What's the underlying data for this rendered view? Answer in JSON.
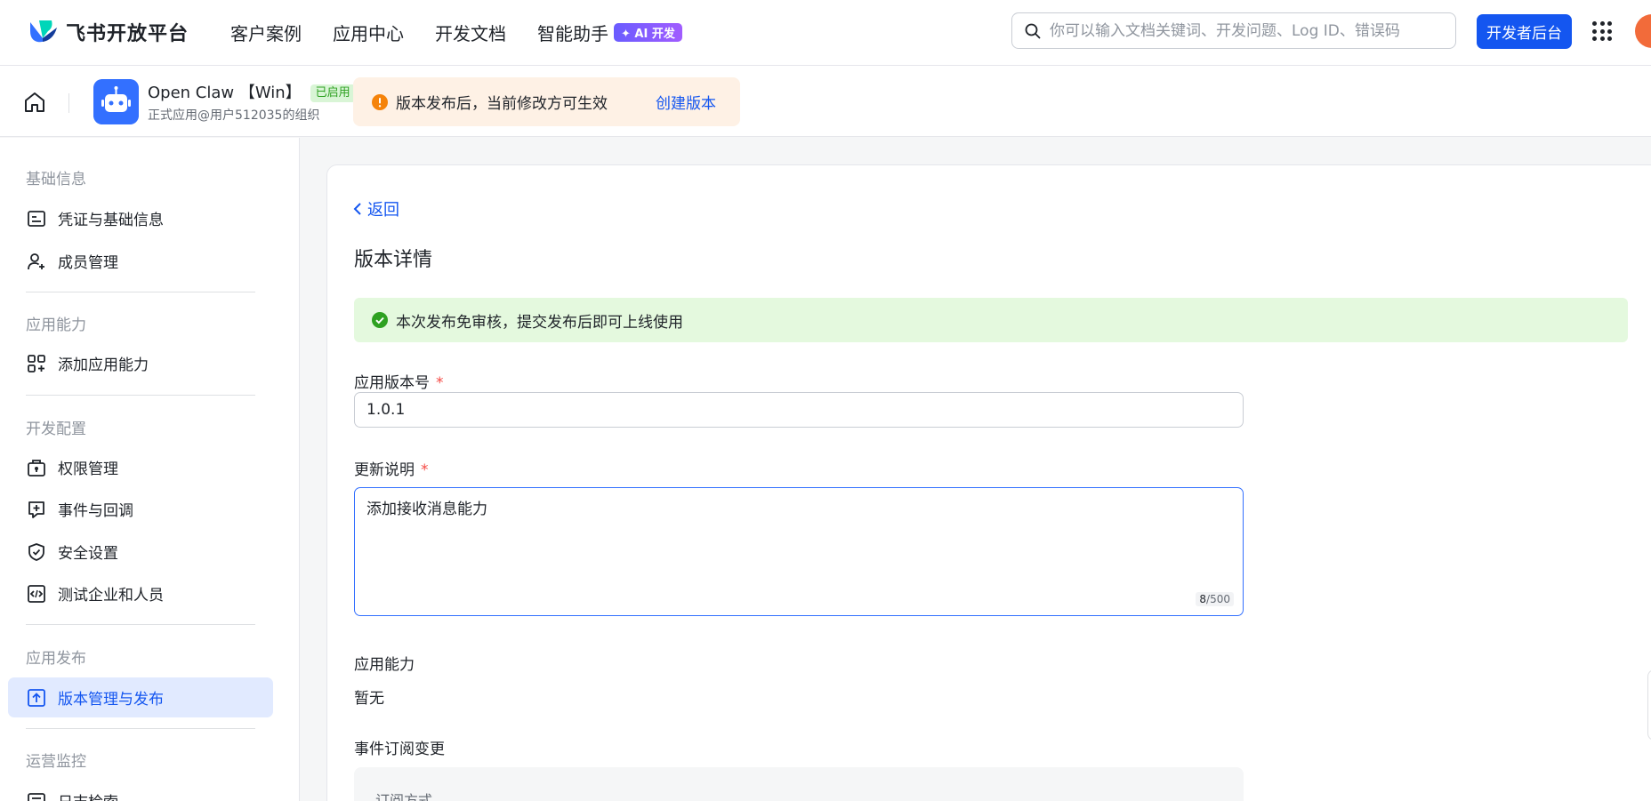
{
  "topnav": {
    "brand": "飞书开放平台",
    "links": [
      "客户案例",
      "应用中心",
      "开发文档",
      "智能助手"
    ],
    "ai_badge": "AI 开发",
    "search_placeholder": "你可以输入文档关键词、开发问题、Log ID、错误码",
    "dev_console_button": "开发者后台"
  },
  "app": {
    "name": "Open Claw 【Win】",
    "status": "已启用",
    "org": "正式应用@用户512035的组织"
  },
  "notice": {
    "text": "版本发布后，当前修改方可生效",
    "link": "创建版本"
  },
  "sidebar": {
    "groups": [
      "基础信息",
      "应用能力",
      "开发配置",
      "应用发布",
      "运营监控"
    ],
    "items": [
      {
        "label": "凭证与基础信息",
        "icon": "credential-icon"
      },
      {
        "label": "成员管理",
        "icon": "member-add-icon"
      },
      {
        "label": "添加应用能力",
        "icon": "grid-add-icon"
      },
      {
        "label": "权限管理",
        "icon": "permission-icon"
      },
      {
        "label": "事件与回调",
        "icon": "event-icon"
      },
      {
        "label": "安全设置",
        "icon": "shield-icon"
      },
      {
        "label": "测试企业和人员",
        "icon": "code-icon"
      },
      {
        "label": "版本管理与发布",
        "icon": "upload-icon",
        "active": true
      },
      {
        "label": "日志检索",
        "icon": "log-icon"
      }
    ]
  },
  "main": {
    "back": "返回",
    "title": "版本详情",
    "success": "本次发布免审核，提交发布后即可上线使用",
    "version_label": "应用版本号",
    "version_value": "1.0.1",
    "notes_label": "更新说明",
    "notes_value": "添加接收消息能力",
    "notes_count": "8",
    "notes_max": "/500",
    "capability_label": "应用能力",
    "capability_value": "暂无",
    "event_label": "事件订阅变更",
    "event_box_header": "订阅方式",
    "required_mark": "*"
  },
  "colors": {
    "primary": "#1456f0",
    "success_bg": "#e4f9de",
    "warning_bg": "#fef1e5",
    "warning_icon": "#f5830a",
    "active_bg": "#e1eaff"
  }
}
